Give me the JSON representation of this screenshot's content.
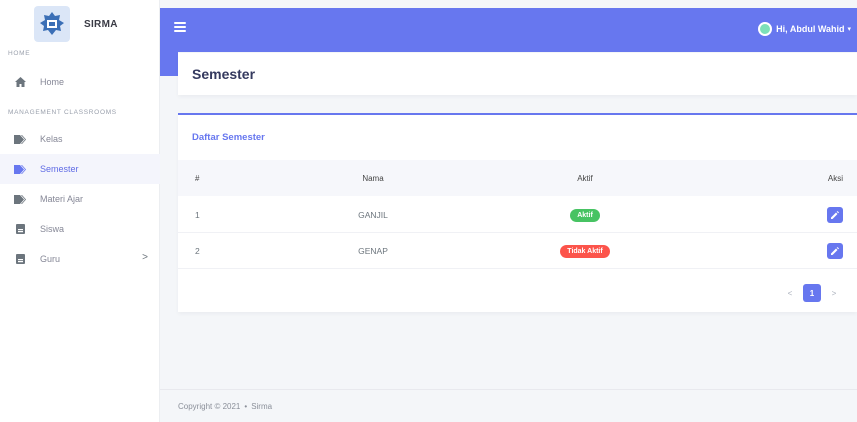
{
  "app": {
    "brand": "SIRMA"
  },
  "sidebar": {
    "section_home": "HOME",
    "section_management": "MANAGEMENT CLASSROOMS",
    "items": [
      {
        "label": "Home",
        "icon": "home-icon"
      },
      {
        "label": "Kelas",
        "icon": "tag-icon"
      },
      {
        "label": "Semester",
        "icon": "tag-icon",
        "active": true
      },
      {
        "label": "Materi Ajar",
        "icon": "tag-icon"
      },
      {
        "label": "Siswa",
        "icon": "id-card-icon"
      },
      {
        "label": "Guru",
        "icon": "id-card-icon",
        "chevron": ">"
      }
    ]
  },
  "header": {
    "user_label": "Hi, Abdul Wahid"
  },
  "page": {
    "title": "Semester"
  },
  "table": {
    "title": "Daftar Semester",
    "columns": [
      "#",
      "Nama",
      "Aktif",
      "Aksi"
    ],
    "rows": [
      {
        "num": "1",
        "nama": "GANJIL",
        "status": "Aktif"
      },
      {
        "num": "2",
        "nama": "GENAP",
        "status": "Tidak Aktif"
      }
    ]
  },
  "pagination": {
    "prev": "<",
    "current": "1",
    "next": ">"
  },
  "footer": {
    "copyright": "Copyright © 2021",
    "app": "Sirma"
  },
  "colors": {
    "primary": "#6777ef",
    "success": "#47c363",
    "danger": "#fc544b"
  }
}
